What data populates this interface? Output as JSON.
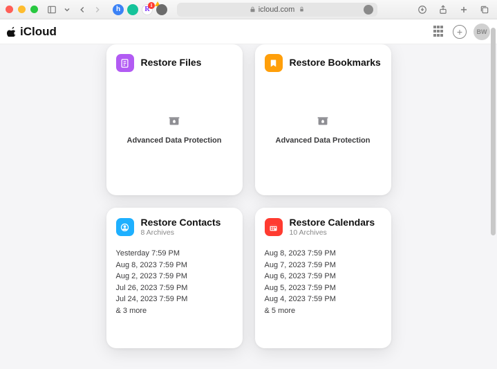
{
  "browser": {
    "url_host": "icloud.com",
    "extensions": [
      {
        "name": "honey",
        "bg": "#3b82f6",
        "glyph": "h"
      },
      {
        "name": "grammarly",
        "bg": "#15c39a",
        "glyph": ""
      },
      {
        "name": "rakuten",
        "bg": "#ffffff",
        "glyph": "R",
        "color": "#7b2ff7",
        "badge": "1"
      },
      {
        "name": "duckduckgo",
        "bg": "#6b6b6b",
        "glyph": ""
      }
    ]
  },
  "app": {
    "title": "iCloud",
    "avatar_initials": "BW"
  },
  "cards": {
    "files": {
      "title": "Restore Files",
      "adp": "Advanced Data Protection"
    },
    "bookmarks": {
      "title": "Restore Bookmarks",
      "adp": "Advanced Data Protection"
    },
    "contacts": {
      "title": "Restore Contacts",
      "subtitle": "8 Archives",
      "archives": [
        "Yesterday 7:59 PM",
        "Aug 8, 2023 7:59 PM",
        "Aug 2, 2023 7:59 PM",
        "Jul 26, 2023 7:59 PM",
        "Jul 24, 2023 7:59 PM"
      ],
      "more": "& 3 more"
    },
    "calendars": {
      "title": "Restore Calendars",
      "subtitle": "10 Archives",
      "archives": [
        "Aug 8, 2023 7:59 PM",
        "Aug 7, 2023 7:59 PM",
        "Aug 6, 2023 7:59 PM",
        "Aug 5, 2023 7:59 PM",
        "Aug 4, 2023 7:59 PM"
      ],
      "more": "& 5 more"
    }
  }
}
